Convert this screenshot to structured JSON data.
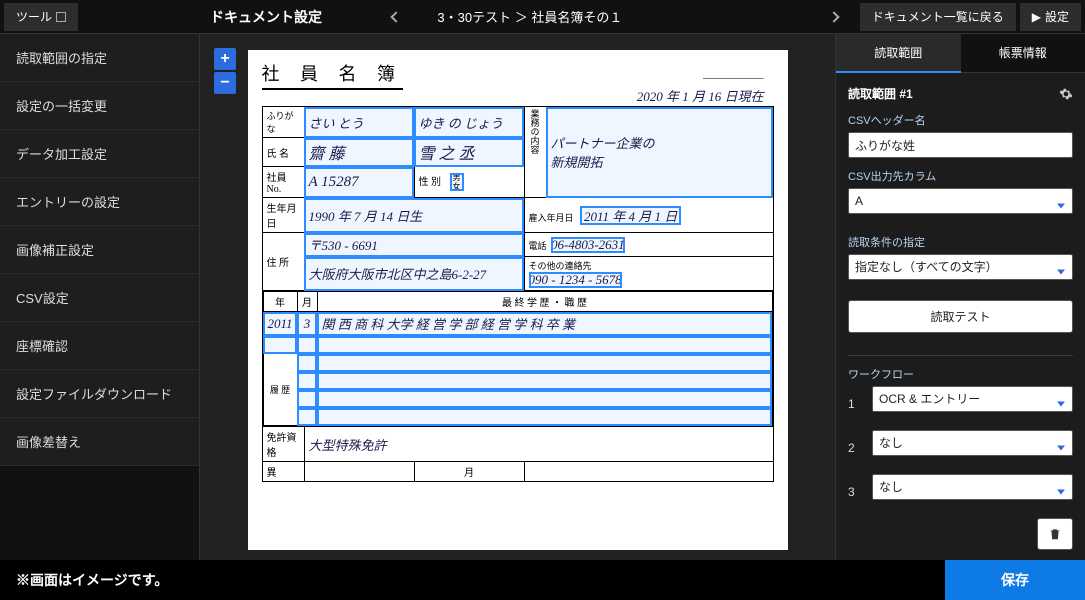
{
  "topbar": {
    "tool_label": "ツール",
    "doc_settings_label": "ドキュメント設定",
    "breadcrumb": "3・30テスト ＞ 社員名簿その１",
    "back_to_list": "ドキュメント一覧に戻る",
    "settings": "設定"
  },
  "sidebar_left": {
    "items": [
      "読取範囲の指定",
      "設定の一括変更",
      "データ加工設定",
      "エントリーの設定",
      "画像補正設定",
      "CSV設定",
      "座標確認",
      "設定ファイルダウンロード",
      "画像差替え"
    ]
  },
  "zoom": {
    "in": "+",
    "out": "−"
  },
  "paper": {
    "title": "社 員 名 簿",
    "no_label": "No.",
    "date_text": "2020 年  1 月  16 日現在",
    "rows": {
      "furigana_label": "ふりがな",
      "furigana_sei": "さい    とう",
      "furigana_mei": "ゆき  の じょう",
      "name_label": "氏 名",
      "name_sei": "齋 藤",
      "name_mei": "雪 之 丞",
      "gyomu_label": "業務の内容",
      "gyomu_text": "パートナー企業の\n新規開拓",
      "emp_no_label": "社員No.",
      "emp_no": "A 15287",
      "sex_label": "性 別",
      "sex_opts": "男\n女",
      "dob_label": "生年月日",
      "dob": "1990 年  7 月 14 日生",
      "hire_label": "雇入年月日",
      "hire": "2011 年  4 月  1  日",
      "addr_label": "住 所",
      "zip": "〒530 - 6691",
      "addr": "大阪府大阪市北区中之島6-2-27",
      "tel_label": "電話",
      "tel": "06-4803-2631",
      "othertel_label": "その他の連絡先",
      "othertel": "090 - 1234 - 5678",
      "edu_header_y": "年",
      "edu_header_m": "月",
      "edu_header": "最 終 学 歴 ・ 職 歴",
      "edu_y": "2011",
      "edu_m": "3",
      "edu_text": "関 西 商 科 大学  経 営 学 部  経 営 学 科  卒 業",
      "rireki_label": "履 歴",
      "license_label": "免許資格",
      "license_text": "大型特殊免許",
      "ireki_y": "年",
      "iireki_m": "月",
      "iireki_header": "異"
    }
  },
  "tabs": {
    "range": "読取範囲",
    "form": "帳票情報"
  },
  "panel": {
    "header": "読取範囲 #1",
    "csv_header_label": "CSVヘッダー名",
    "csv_header_value": "ふりがな姓",
    "csv_col_label": "CSV出力先カラム",
    "csv_col_value": "A",
    "cond_label": "読取条件の指定",
    "cond_value": "指定なし（すべての文字）",
    "test_btn": "読取テスト",
    "workflow_label": "ワークフロー",
    "workflow": [
      {
        "n": "1",
        "v": "OCR & エントリー"
      },
      {
        "n": "2",
        "v": "なし"
      },
      {
        "n": "3",
        "v": "なし"
      }
    ]
  },
  "bottom": {
    "note": "※画面はイメージです。",
    "save": "保存"
  }
}
